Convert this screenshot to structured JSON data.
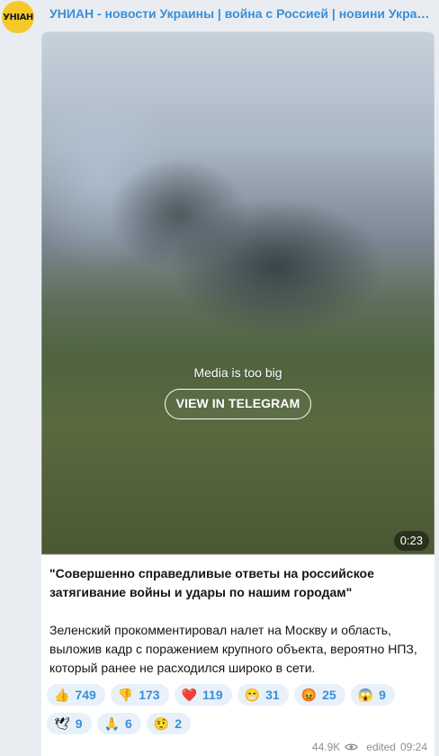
{
  "channel": {
    "avatar_text": "УНІАН",
    "title": "УНИАН - новости Украины | война с Россией | новини Україні…"
  },
  "media": {
    "message": "Media is too big",
    "button_label": "VIEW IN TELEGRAM",
    "duration": "0:23"
  },
  "post": {
    "headline": "\"Совершенно справедливые ответы на российское затягивание войны и удары по нашим городам\"",
    "body": "Зеленский прокомментировал налет на Москву и область, выложив кадр с поражением крупного объекта, вероятно НПЗ, который ранее не расходился широко в сети."
  },
  "reactions": [
    {
      "emoji": "👍",
      "count": "749"
    },
    {
      "emoji": "👎",
      "count": "173"
    },
    {
      "emoji": "❤️",
      "count": "119"
    },
    {
      "emoji": "😁",
      "count": "31"
    },
    {
      "emoji": "😡",
      "count": "25"
    },
    {
      "emoji": "😱",
      "count": "9"
    },
    {
      "emoji": "🕊",
      "count": "9"
    },
    {
      "emoji": "🙏",
      "count": "6"
    },
    {
      "emoji": "🤨",
      "count": "2"
    }
  ],
  "footer": {
    "views": "44.9K",
    "view_icon": "eye-icon",
    "edited": "edited",
    "time": "09:24"
  },
  "colors": {
    "accent": "#3a8fd6",
    "background": "#e9edf1",
    "avatar": "#f6c82a",
    "reaction_bg": "#e8f1fa"
  }
}
